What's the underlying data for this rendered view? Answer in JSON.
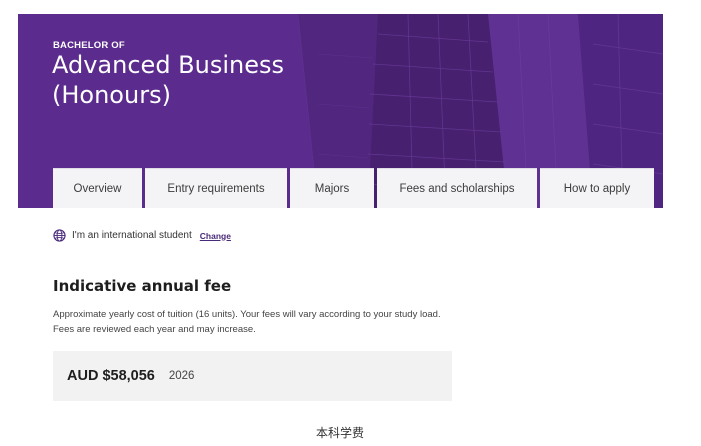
{
  "hero": {
    "subtitle": "BACHELOR OF",
    "title": "Advanced Business (Honours)"
  },
  "tabs": [
    {
      "label": "Overview"
    },
    {
      "label": "Entry requirements"
    },
    {
      "label": "Majors"
    },
    {
      "label": "Fees and scholarships"
    },
    {
      "label": "How to apply"
    }
  ],
  "student": {
    "icon": "globe-icon",
    "text": "I'm an international student",
    "change_label": "Change"
  },
  "fees": {
    "heading": "Indicative annual fee",
    "description": "Approximate yearly cost of tuition (16 units). Your fees will vary according to your study load. Fees are reviewed each year and may increase.",
    "amount": "AUD $58,056",
    "year": "2026"
  },
  "caption": "本科学费",
  "colors": {
    "hero_purple": "#5a2a8c",
    "tab_bg": "#f4f3f6",
    "fee_box_bg": "#f2f2f2",
    "link": "#4a2a7a"
  }
}
